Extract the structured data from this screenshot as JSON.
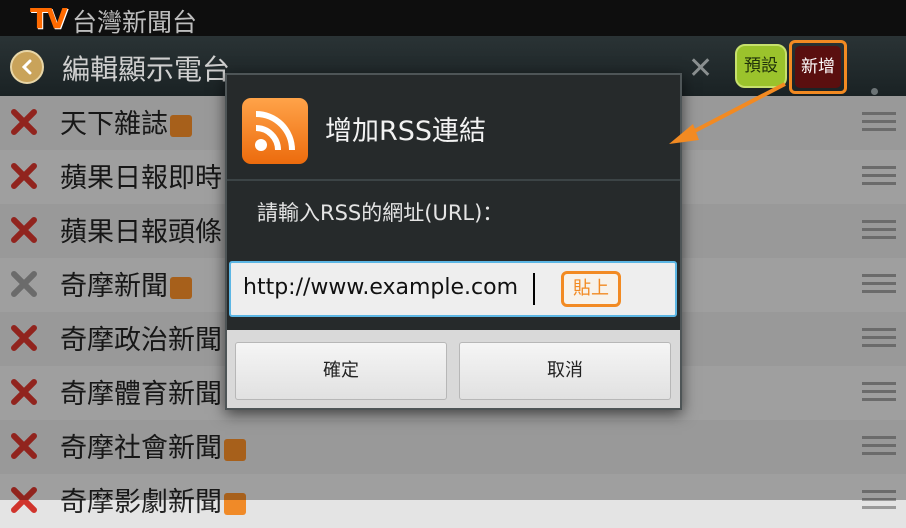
{
  "app": {
    "logo": "TV",
    "name": "台灣新聞台"
  },
  "titlebar": {
    "title": "編輯顯示電台",
    "back_icon": "chevron-left-icon",
    "clear_icon": "close-icon",
    "preset_label": "預設",
    "add_label": "新增",
    "overflow_icon": "more-vertical-icon"
  },
  "list": {
    "items": [
      {
        "name": "天下雜誌",
        "rss": true
      },
      {
        "name": "蘋果日報即時",
        "rss": false
      },
      {
        "name": "蘋果日報頭條",
        "rss": false
      },
      {
        "name": "奇摩新聞",
        "rss": true
      },
      {
        "name": "奇摩政治新聞",
        "rss": false
      },
      {
        "name": "奇摩體育新聞",
        "rss": false
      },
      {
        "name": "奇摩社會新聞",
        "rss": true
      },
      {
        "name": "奇摩影劇新聞",
        "rss": true
      }
    ]
  },
  "dialog": {
    "icon": "rss-icon",
    "title": "增加RSS連結",
    "prompt": "請輸入RSS的網址(URL)：",
    "url_value": "http://www.example.com",
    "paste_label": "貼上",
    "confirm_label": "確定",
    "cancel_label": "取消"
  },
  "colors": {
    "accent_orange": "#f28a22",
    "rss_orange": "#f08a28",
    "input_focus": "#5cb6e4"
  }
}
